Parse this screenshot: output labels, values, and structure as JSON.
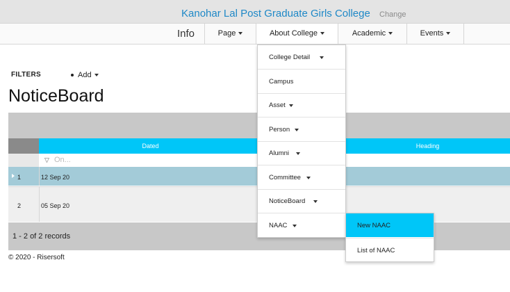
{
  "header": {
    "college_name": "Kanohar Lal Post Graduate Girls College",
    "change_label": "Change"
  },
  "nav": {
    "info_label": "Info",
    "items": [
      {
        "label": "Page"
      },
      {
        "label": "About College"
      },
      {
        "label": "Academic"
      },
      {
        "label": "Events"
      }
    ]
  },
  "toolbar": {
    "filters_label": "FILTERS",
    "add_label": "Add"
  },
  "page": {
    "title": "NoticeBoard"
  },
  "grid": {
    "columns": [
      "Dated",
      "Heading"
    ],
    "filter_placeholder": "On...",
    "rows": [
      {
        "num": "1",
        "dated": "12 Sep 20"
      },
      {
        "num": "2",
        "dated": "05 Sep 20"
      }
    ],
    "pager_text": "1 - 2 of 2 records"
  },
  "footer": {
    "text": "© 2020 - Risersoft"
  },
  "dropdown": {
    "items": [
      {
        "label": "College Detail",
        "has_caret": true
      },
      {
        "label": "Campus",
        "has_caret": false
      },
      {
        "label": "Asset",
        "has_caret": true
      },
      {
        "label": "Person",
        "has_caret": true
      },
      {
        "label": "Alumni",
        "has_caret": true
      },
      {
        "label": "Committee",
        "has_caret": true
      },
      {
        "label": "NoticeBoard",
        "has_caret": true
      },
      {
        "label": "NAAC",
        "has_caret": true
      }
    ]
  },
  "submenu": {
    "items": [
      {
        "label": "New NAAC",
        "highlighted": true
      },
      {
        "label": "List of NAAC",
        "highlighted": false
      }
    ]
  },
  "colors": {
    "accent": "#00c6f8",
    "brand_text": "#1e88c7",
    "selected_row": "#a3cbd8"
  }
}
